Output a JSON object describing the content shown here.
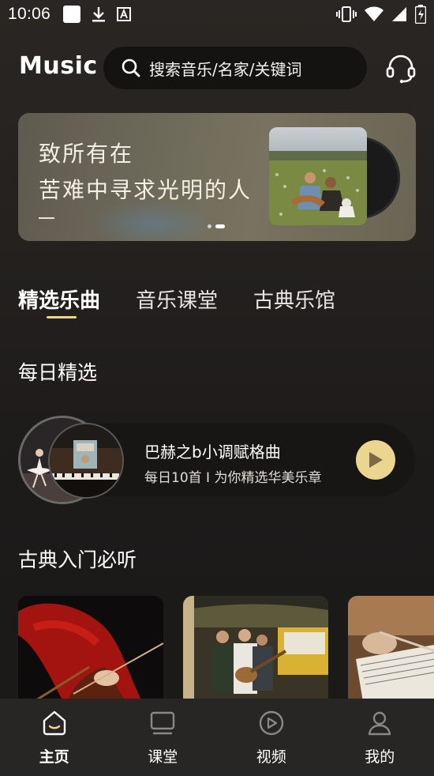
{
  "status_bar": {
    "time": "10:06"
  },
  "header": {
    "logo": "Music",
    "search_placeholder": "搜索音乐/名家/关键词"
  },
  "banner": {
    "line1": "致所有在",
    "line2": "苦难中寻求光明的人"
  },
  "tabs": [
    {
      "label": "精选乐曲",
      "active": true
    },
    {
      "label": "音乐课堂",
      "active": false
    },
    {
      "label": "古典乐馆",
      "active": false
    }
  ],
  "daily": {
    "section_title": "每日精选",
    "title": "巴赫之b小调赋格曲",
    "subtitle": "每日10首 I 为你精选华美乐章"
  },
  "classics": {
    "section_title": "古典入门必听"
  },
  "bottom_nav": [
    {
      "label": "主页",
      "icon": "home-icon",
      "active": true
    },
    {
      "label": "课堂",
      "icon": "classroom-icon",
      "active": false
    },
    {
      "label": "视频",
      "icon": "video-icon",
      "active": false
    },
    {
      "label": "我的",
      "icon": "profile-icon",
      "active": false
    }
  ],
  "colors": {
    "accent": "#ecd58f",
    "background": "#1d1b1a",
    "nav_background": "#272624"
  }
}
